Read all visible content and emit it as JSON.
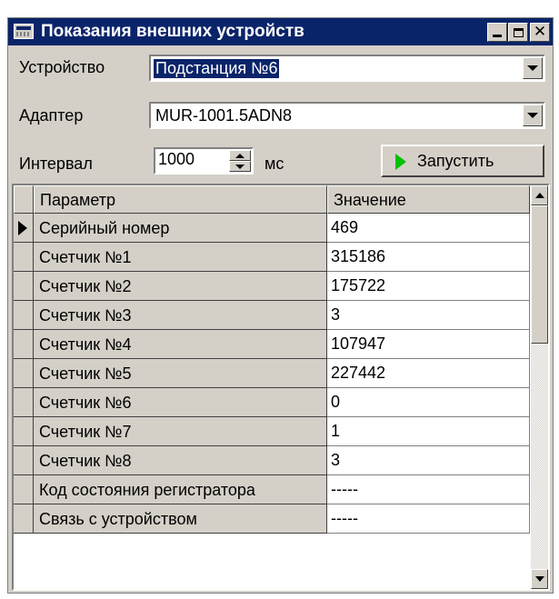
{
  "window": {
    "title": "Показания внешних устройств"
  },
  "form": {
    "device_label": "Устройство",
    "device_value": "Подстанция №6",
    "adapter_label": "Адаптер",
    "adapter_value": "MUR-1001.5ADN8",
    "interval_label": "Интервал",
    "interval_value": "1000",
    "interval_unit": "мс",
    "run_label": "Запустить"
  },
  "grid": {
    "columns": [
      "Параметр",
      "Значение"
    ],
    "rows": [
      {
        "param": "Серийный номер",
        "value": "469"
      },
      {
        "param": "Счетчик №1",
        "value": "315186"
      },
      {
        "param": "Счетчик №2",
        "value": "175722"
      },
      {
        "param": "Счетчик №3",
        "value": "3"
      },
      {
        "param": "Счетчик №4",
        "value": "107947"
      },
      {
        "param": "Счетчик №5",
        "value": "227442"
      },
      {
        "param": "Счетчик №6",
        "value": "0"
      },
      {
        "param": "Счетчик №7",
        "value": "1"
      },
      {
        "param": "Счетчик №8",
        "value": "3"
      },
      {
        "param": "Код состояния регистратора",
        "value": "-----"
      },
      {
        "param": "Связь с устройством",
        "value": "-----"
      }
    ],
    "current_row": 0
  },
  "colors": {
    "titlebar": "#0a246a",
    "face": "#d4d0c8",
    "run_icon": "#00c000"
  }
}
